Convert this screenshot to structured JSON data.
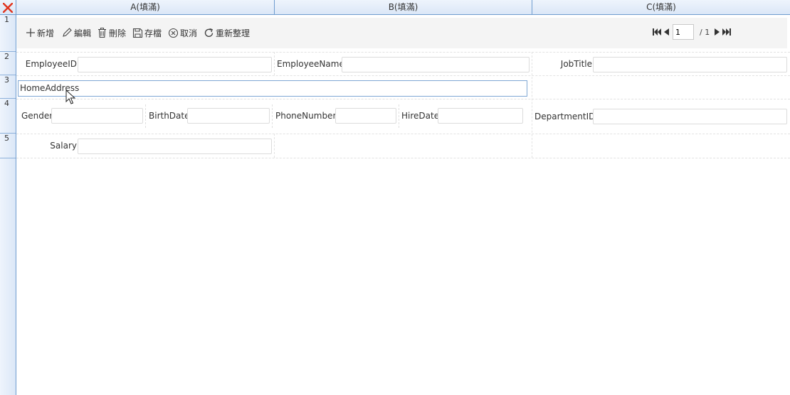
{
  "columns": [
    {
      "label": "A(填滿)"
    },
    {
      "label": "B(填滿)"
    },
    {
      "label": "C(填滿)"
    }
  ],
  "rows": [
    "1",
    "2",
    "3",
    "4",
    "5"
  ],
  "toolbar": {
    "add": "新增",
    "edit": "編輯",
    "delete": "刪除",
    "save": "存檔",
    "cancel": "取消",
    "refresh": "重新整理"
  },
  "pager": {
    "current_page": "1",
    "total": "/ 1"
  },
  "fields": {
    "employee_id": {
      "label": "EmployeeID",
      "value": ""
    },
    "employee_name": {
      "label": "EmployeeName",
      "value": ""
    },
    "job_title": {
      "label": "JobTitle",
      "value": ""
    },
    "home_address": {
      "label": "HomeAddress",
      "value": ""
    },
    "gender": {
      "label": "Gender",
      "value": ""
    },
    "birth_date": {
      "label": "BirthDate",
      "value": ""
    },
    "phone_number": {
      "label": "PhoneNumber",
      "value": ""
    },
    "hire_date": {
      "label": "HireDate",
      "value": ""
    },
    "department_id": {
      "label": "DepartmentID",
      "value": ""
    },
    "salary": {
      "label": "Salary",
      "value": ""
    }
  },
  "colors": {
    "header_border": "#6e9ccf",
    "corner_x": "#e0341e",
    "toolbar_bg": "#f4f4f4",
    "active_field_border": "#7fa7d4"
  }
}
